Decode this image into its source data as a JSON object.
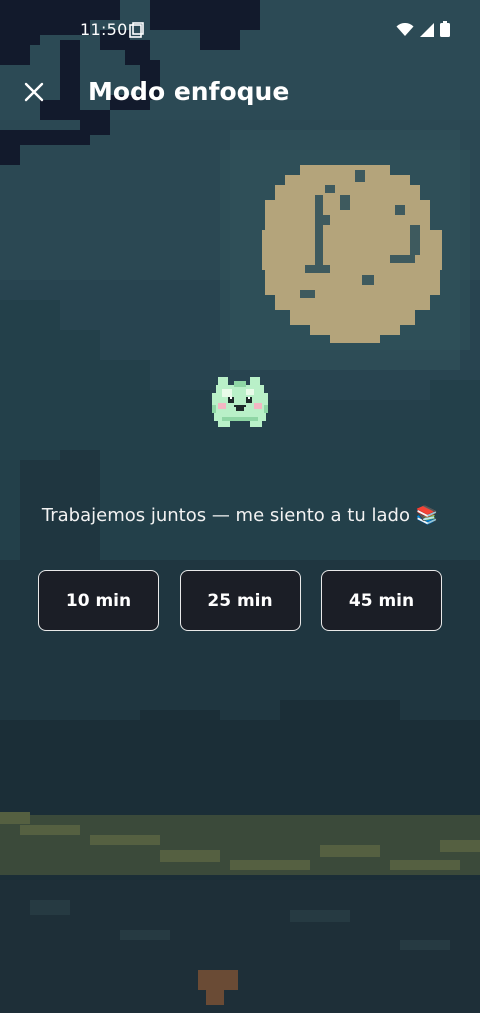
{
  "status_bar": {
    "time": "11:50",
    "icons": [
      "notification-icon",
      "wifi-icon",
      "signal-icon",
      "battery-icon"
    ]
  },
  "header": {
    "title": "Modo enfoque",
    "close_icon": "close-icon"
  },
  "message": "Trabajemos juntos — me siento a tu lado 📚",
  "durations": [
    {
      "label": "10 min"
    },
    {
      "label": "25 min"
    },
    {
      "label": "45 min"
    }
  ],
  "colors": {
    "background_top": "#2a4650",
    "background_bottom": "#1e313a",
    "moon": "#b5a57c",
    "button_bg": "#1b1e26",
    "button_border": "#e9e9e9",
    "pet": "#b9f0c8"
  }
}
